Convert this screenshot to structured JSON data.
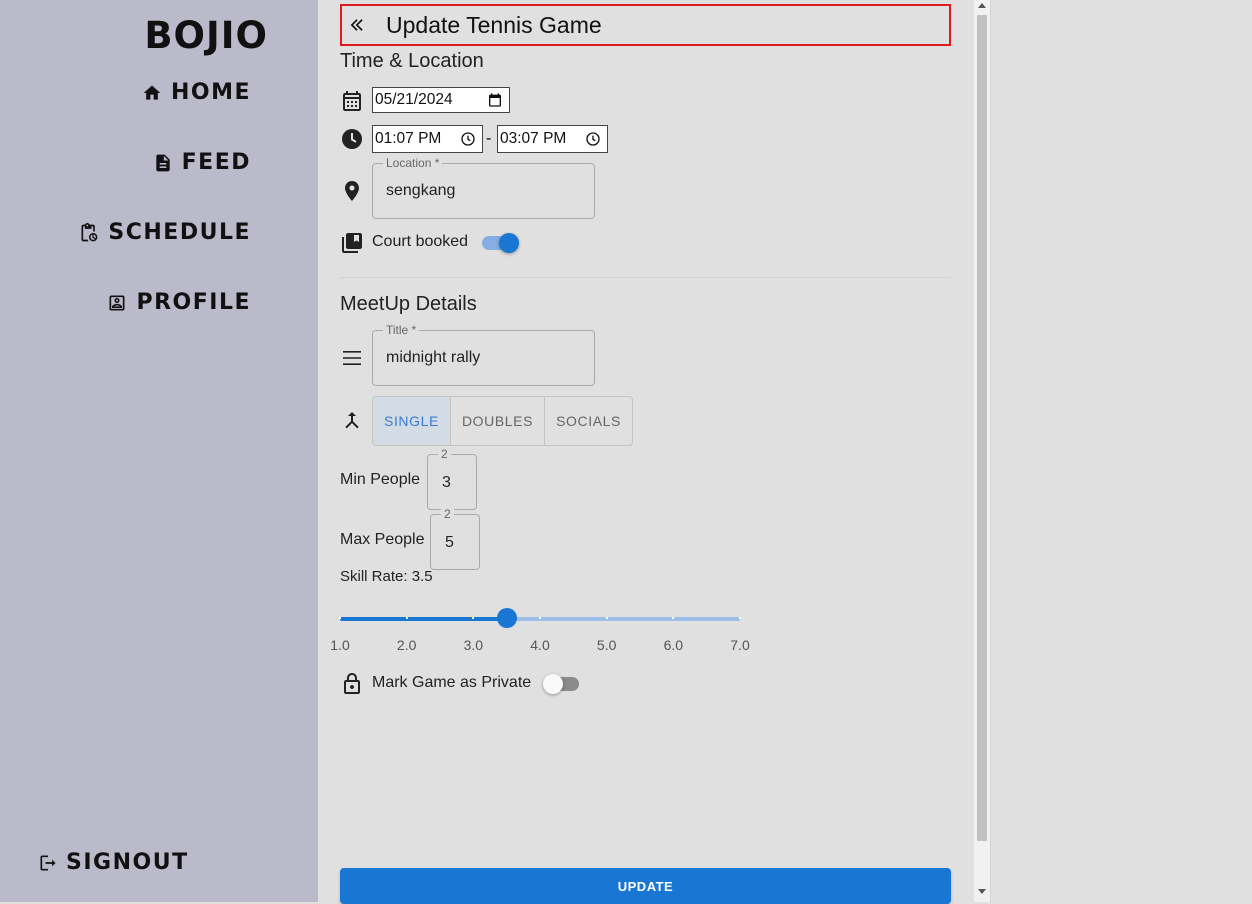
{
  "sidebar": {
    "brand": "BOJIO",
    "items": [
      {
        "label": "HOME",
        "icon": "home-icon"
      },
      {
        "label": "FEED",
        "icon": "document-icon"
      },
      {
        "label": "SCHEDULE",
        "icon": "clipboard-clock-icon"
      },
      {
        "label": "PROFILE",
        "icon": "person-card-icon"
      }
    ],
    "signout_label": "SIGNOUT"
  },
  "header": {
    "title": "Update Tennis Game"
  },
  "time_location": {
    "section_title": "Time & Location",
    "date_value": "05/21/2024",
    "start_time": "01:07 PM",
    "time_separator": "-",
    "end_time": "03:07 PM",
    "location_label": "Location *",
    "location_value": "sengkang",
    "court_booked_label": "Court booked",
    "court_booked": true
  },
  "meetup": {
    "section_title": "MeetUp Details",
    "title_label": "Title *",
    "title_value": "midnight rally",
    "game_types": [
      "SINGLE",
      "DOUBLES",
      "SOCIALS"
    ],
    "selected_game_type": "SINGLE",
    "min_people_label": "Min People",
    "min_people_floating": "2",
    "min_people_value": "3",
    "max_people_label": "Max People",
    "max_people_floating": "2",
    "max_people_value": "5",
    "skill_rate_label": "Skill Rate: 3.5",
    "skill_rate": 3.5,
    "skill_min": 1.0,
    "skill_max": 7.0,
    "skill_ticks": [
      "1.0",
      "2.0",
      "3.0",
      "4.0",
      "5.0",
      "6.0",
      "7.0"
    ],
    "private_label": "Mark Game as Private",
    "is_private": false
  },
  "actions": {
    "update_label": "UPDATE"
  },
  "colors": {
    "sidebar_bg": "#bbbacb",
    "main_bg": "#e0e0e0",
    "accent": "#1976d2",
    "title_border": "#e0191c"
  }
}
